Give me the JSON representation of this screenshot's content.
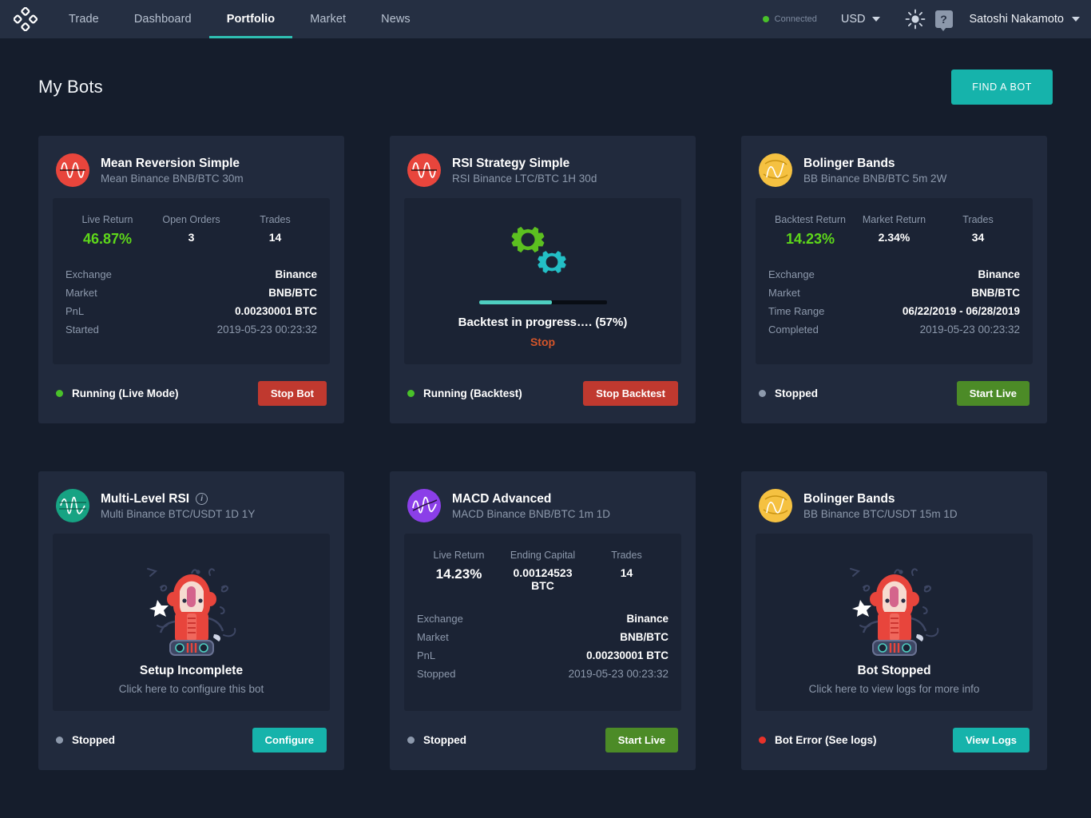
{
  "header": {
    "logo_icon": "diamond-cluster-logo",
    "nav": [
      {
        "label": "Trade",
        "active": false
      },
      {
        "label": "Dashboard",
        "active": false
      },
      {
        "label": "Portfolio",
        "active": true
      },
      {
        "label": "Market",
        "active": false
      },
      {
        "label": "News",
        "active": false
      }
    ],
    "connection": {
      "label": "Connected",
      "color": "#49c12a"
    },
    "currency": "USD",
    "theme_icon": "sun-icon",
    "help_icon": "question-mark-icon",
    "user": "Satoshi Nakamoto",
    "accent": "#2fbfb2",
    "background": "#252f42"
  },
  "page": {
    "title": "My Bots",
    "find_bot_label": "FIND A BOT",
    "background": "#151d2c",
    "card_background": "#212a3d",
    "panel_background": "#1b2334"
  },
  "bots": [
    {
      "name": "Mean Reversion Simple",
      "subtitle": "Mean Binance BNB/BTC 30m",
      "avatar": {
        "icon": "wave-oscillator-icon",
        "color": "#e8453c"
      },
      "layout": "stats",
      "stats": [
        {
          "label": "Live Return",
          "value": "46.87%",
          "style": "big-green"
        },
        {
          "label": "Open Orders",
          "value": "3",
          "style": ""
        },
        {
          "label": "Trades",
          "value": "14",
          "style": ""
        }
      ],
      "rows": [
        {
          "key": "Exchange",
          "value": "Binance",
          "muted": false
        },
        {
          "key": "Market",
          "value": "BNB/BTC",
          "muted": false
        },
        {
          "key": "PnL",
          "value": "0.00230001 BTC",
          "muted": false
        },
        {
          "key": "Started",
          "value": "2019-05-23  00:23:32",
          "muted": true
        }
      ],
      "status": {
        "label": "Running (Live Mode)",
        "color": "#49c12a"
      },
      "action": {
        "label": "Stop Bot",
        "style": "btn-red"
      }
    },
    {
      "name": "RSI Strategy Simple",
      "subtitle": "RSI Binance LTC/BTC 1H 30d",
      "avatar": {
        "icon": "wave-oscillator-icon",
        "color": "#e8453c"
      },
      "layout": "progress",
      "progress": {
        "icon": "gears-icon",
        "percent": 57,
        "text": "Backtest in progress…. (57%)",
        "stop_label": "Stop",
        "fill_color": "#4ecec0",
        "track_color": "#090d14"
      },
      "status": {
        "label": "Running (Backtest)",
        "color": "#49c12a"
      },
      "action": {
        "label": "Stop Backtest",
        "style": "btn-red"
      }
    },
    {
      "name": "Bolinger Bands",
      "subtitle": "BB Binance BNB/BTC 5m 2W",
      "avatar": {
        "icon": "bollinger-ball-icon",
        "color": "#f5c141"
      },
      "layout": "stats",
      "stats": [
        {
          "label": "Backtest Return",
          "value": "14.23%",
          "style": "big-green"
        },
        {
          "label": "Market Return",
          "value": "2.34%",
          "style": ""
        },
        {
          "label": "Trades",
          "value": "34",
          "style": ""
        }
      ],
      "rows": [
        {
          "key": "Exchange",
          "value": "Binance",
          "muted": false
        },
        {
          "key": "Market",
          "value": "BNB/BTC",
          "muted": false
        },
        {
          "key": "Time Range",
          "value": "06/22/2019 - 06/28/2019",
          "muted": false
        },
        {
          "key": "Completed",
          "value": "2019-05-23  00:23:32",
          "muted": true
        }
      ],
      "status": {
        "label": "Stopped",
        "color": "#8d99ac"
      },
      "action": {
        "label": "Start Live",
        "style": "btn-green"
      }
    },
    {
      "name": "Multi-Level RSI",
      "subtitle": "Multi Binance BTC/USDT 1D 1Y",
      "avatar": {
        "icon": "wave-oscillator-icon",
        "color": "#17a383"
      },
      "info_icon": "info-icon",
      "layout": "empty",
      "empty": {
        "icon": "robot-illustration",
        "title": "Setup Incomplete",
        "subtitle": "Click  here to configure this bot"
      },
      "status": {
        "label": "Stopped",
        "color": "#8d99ac"
      },
      "action": {
        "label": "Configure",
        "style": "btn-teal"
      }
    },
    {
      "name": "MACD Advanced",
      "subtitle": "MACD Binance BNB/BTC 1m 1D",
      "avatar": {
        "icon": "macd-wave-icon",
        "color": "#8b3fe8"
      },
      "layout": "stats",
      "stats": [
        {
          "label": "Live Return",
          "value": "14.23%",
          "style": "big-white"
        },
        {
          "label": "Ending Capital",
          "value": "0.00124523 BTC",
          "style": "big-white"
        },
        {
          "label": "Trades",
          "value": "14",
          "style": ""
        }
      ],
      "rows": [
        {
          "key": "Exchange",
          "value": "Binance",
          "muted": false
        },
        {
          "key": "Market",
          "value": "BNB/BTC",
          "muted": false
        },
        {
          "key": "PnL",
          "value": "0.00230001 BTC",
          "muted": false
        },
        {
          "key": "Stopped",
          "value": "2019-05-23  00:23:32",
          "muted": true
        }
      ],
      "status": {
        "label": "Stopped",
        "color": "#8d99ac"
      },
      "action": {
        "label": "Start Live",
        "style": "btn-green"
      }
    },
    {
      "name": "Bolinger Bands",
      "subtitle": "BB Binance BTC/USDT 15m 1D",
      "avatar": {
        "icon": "bollinger-ball-icon",
        "color": "#f5c141"
      },
      "layout": "empty",
      "empty": {
        "icon": "robot-illustration",
        "title": "Bot Stopped",
        "subtitle": "Click here to view logs for more info"
      },
      "status": {
        "label": "Bot Error (See logs)",
        "color": "#e8322a"
      },
      "action": {
        "label": "View Logs",
        "style": "btn-teal"
      }
    }
  ]
}
